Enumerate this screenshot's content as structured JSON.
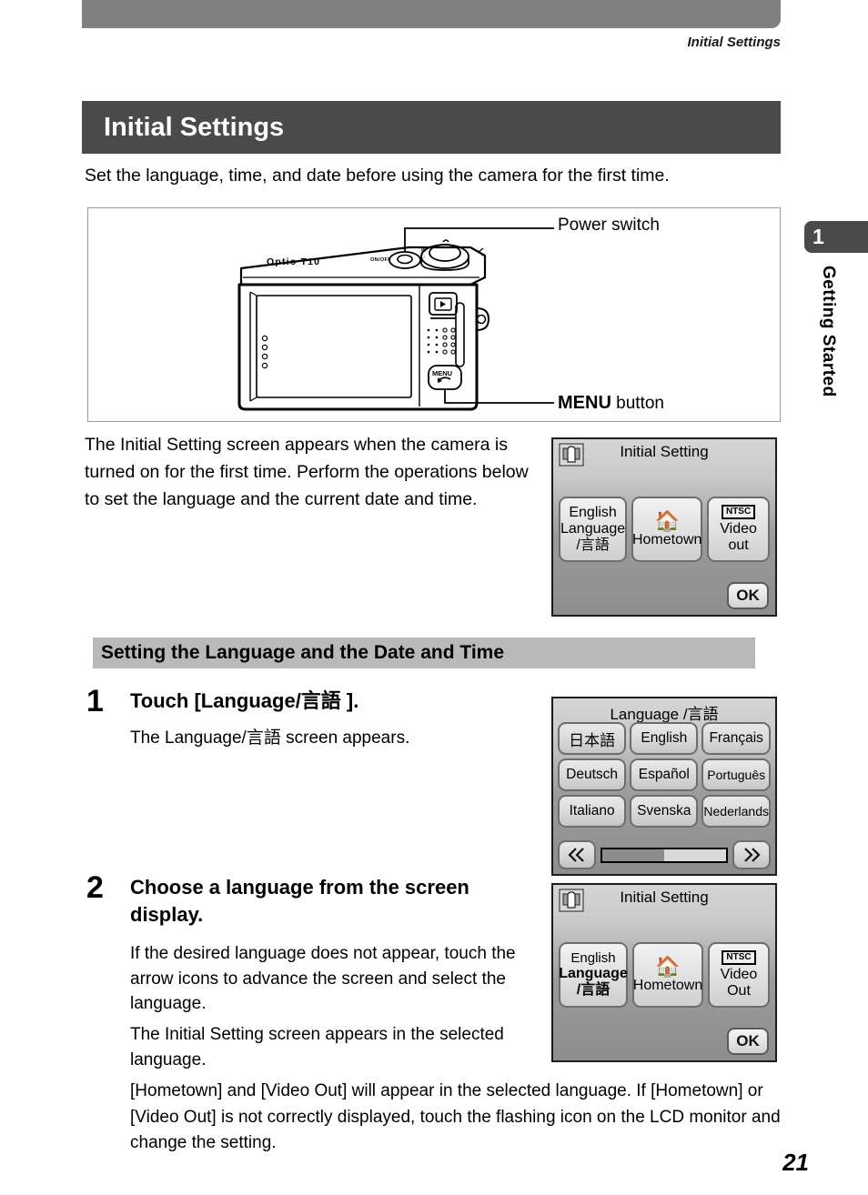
{
  "running_head": "Initial Settings",
  "chapter": {
    "number": "1",
    "label": "Getting Started"
  },
  "page_title": "Initial Settings",
  "intro": "Set the language, time, and date before using the camera for the first time.",
  "illustration": {
    "camera_model": "Optio T10",
    "power_label_text": "Power switch",
    "menu_label_bold": "MENU",
    "menu_label_rest": " button",
    "power_switch_text": "ON/OFF",
    "playback_icon": "playback-icon",
    "menu_button_text": "MENU"
  },
  "body_paragraph": "The Initial Setting screen appears when the camera is turned on for the first time. Perform the operations below to set the language and the current date and time.",
  "lcd_initial_setting_1": {
    "header": "Initial Setting",
    "touch_icon": "finger-touch-icon",
    "buttons": [
      {
        "line1": "English",
        "line2": "Language",
        "line3": "/言語",
        "bold_line": 0
      },
      {
        "icon": "home-icon",
        "label": "Hometown"
      },
      {
        "badge": "NTSC",
        "line1": "Video",
        "line2": "out"
      }
    ],
    "ok_label": "OK"
  },
  "section_heading": "Setting the Language and the Date and Time",
  "steps": [
    {
      "number": "1",
      "title": "Touch [Language/言語 ].",
      "body": [
        "The Language/言語  screen appears."
      ]
    },
    {
      "number": "2",
      "title": "Choose a language from the screen display.",
      "body": [
        "If the desired language does not appear, touch the arrow icons to advance the screen and select the language.",
        "The Initial Setting screen appears in the selected language."
      ]
    }
  ],
  "lcd_language": {
    "header": "Language /言語",
    "languages": [
      "日本語",
      "English",
      "Français",
      "Deutsch",
      "Español",
      "Português",
      "Italiano",
      "Svenska",
      "Nederlands"
    ],
    "prev_icon": "chevron-double-left-icon",
    "next_icon": "chevron-double-right-icon",
    "scroll_percent": 50
  },
  "lcd_initial_setting_2": {
    "header": "Initial Setting",
    "touch_icon": "finger-touch-icon",
    "buttons": [
      {
        "line1": "English",
        "line2": "Language",
        "line3": "/言語",
        "bold_line": 2
      },
      {
        "icon": "home-icon",
        "label": "Hometown"
      },
      {
        "badge": "NTSC",
        "line1": "Video",
        "line2": "Out"
      }
    ],
    "ok_label": "OK"
  },
  "footer_note": "[Hometown] and [Video Out] will appear in the selected language. If [Hometown] or [Video Out] is not correctly displayed, touch the flashing icon on the LCD monitor and change the setting.",
  "page_number": "21",
  "colors": {
    "title_band": "#4a4a4a",
    "top_bar": "#808080",
    "section_band": "#b9b9b9",
    "lcd_border": "#1c1c1c"
  }
}
